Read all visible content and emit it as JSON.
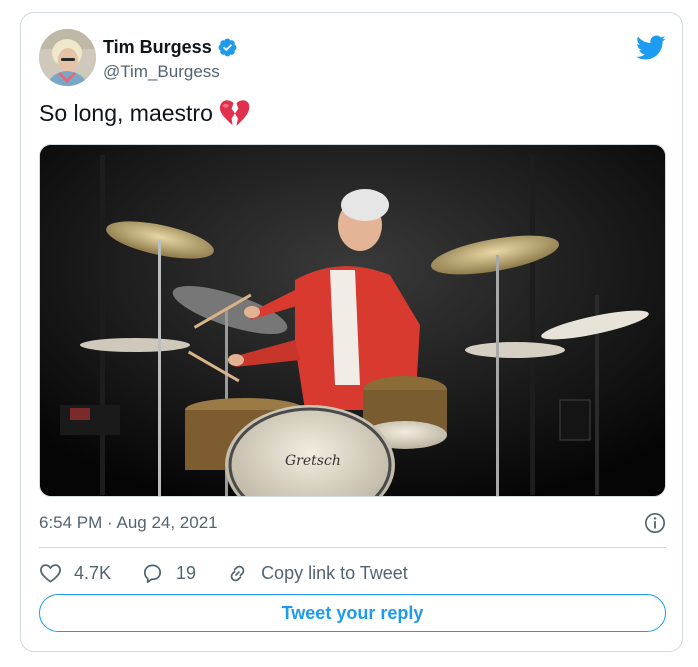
{
  "tweet": {
    "author": {
      "display_name": "Tim Burgess",
      "handle": "@Tim_Burgess",
      "verified": true,
      "avatar_icon": "avatar-photo"
    },
    "text": "So long, maestro",
    "emoji_icon": "broken-heart-icon",
    "media": {
      "kind": "photo",
      "drum_brand_text": "Gretsch"
    },
    "timestamp": "6:54 PM · Aug 24, 2021",
    "actions": {
      "likes": "4.7K",
      "replies": "19",
      "copy_link_label": "Copy link to Tweet"
    },
    "reply_button_label": "Tweet your reply"
  },
  "colors": {
    "brand_blue": "#1d9bf0",
    "secondary_text": "#536471",
    "broken_heart": "#e0304b",
    "border": "#cfd9de"
  }
}
